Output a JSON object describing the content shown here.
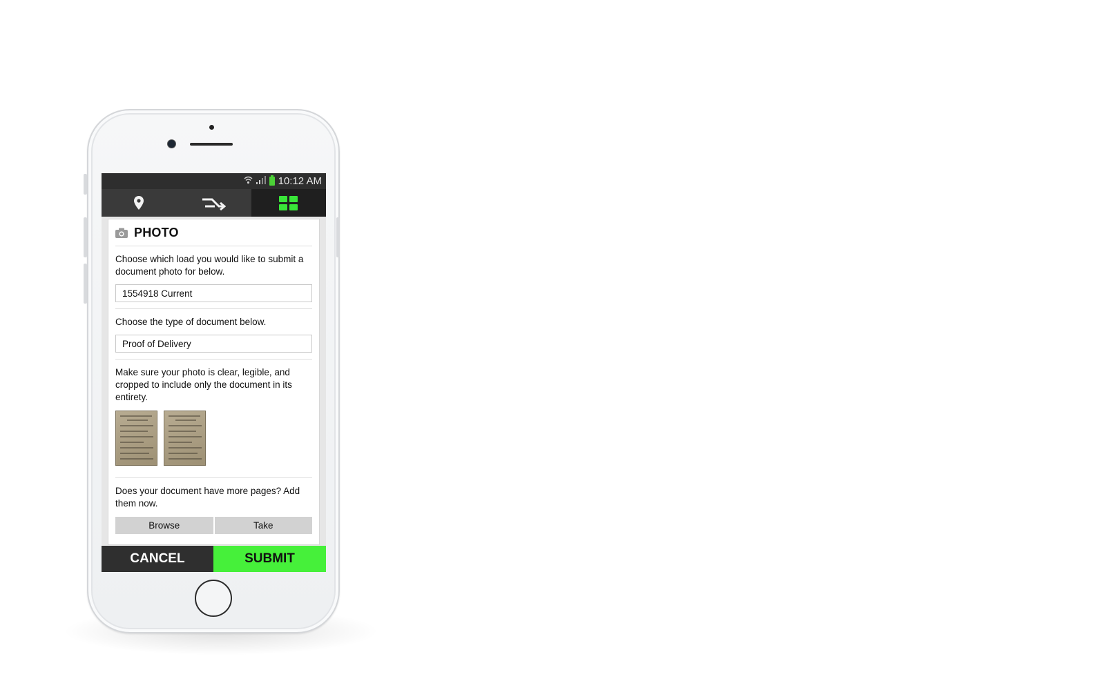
{
  "statusbar": {
    "time": "10:12 AM",
    "wifi_icon": "wifi-icon",
    "signal_icon": "signal-icon",
    "battery_icon": "battery-icon"
  },
  "topnav": {
    "tabs": [
      {
        "icon": "location-pin-icon"
      },
      {
        "icon": "route-arrow-icon"
      },
      {
        "icon": "grid-icon",
        "active": true,
        "color": "#39e639"
      }
    ]
  },
  "form": {
    "title": "PHOTO",
    "title_icon": "camera-icon",
    "load_instruction": "Choose which load you would like to submit a document photo for below.",
    "load_value": "1554918 Current",
    "doctype_instruction": "Choose the type of document below.",
    "doctype_value": "Proof of Delivery",
    "photo_instruction": "Make sure your photo is clear, legible, and cropped to include only the document in its entirety.",
    "thumbnails": [
      "document-thumbnail-1",
      "document-thumbnail-2"
    ],
    "more_pages_instruction": "Does your document have more pages? Add them now.",
    "browse_label": "Browse",
    "take_label": "Take"
  },
  "footer": {
    "cancel_label": "CANCEL",
    "submit_label": "SUBMIT",
    "submit_color": "#46f03a"
  }
}
